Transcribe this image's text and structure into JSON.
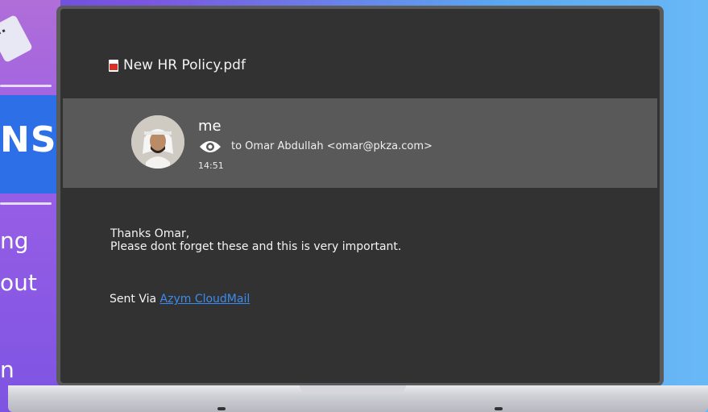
{
  "background": {
    "banner_text": "NS",
    "words": [
      "ng",
      "out",
      "n"
    ]
  },
  "email": {
    "attachment_name": "New HR Policy.pdf",
    "sender": "me",
    "to_line": "to Omar Abdullah <omar@pkza.com>",
    "time": "14:51",
    "body_lines": [
      "Thanks Omar,",
      "Please dont  forget these and this is very important."
    ],
    "sent_via_prefix": "Sent Via ",
    "sent_via_link": "Azym CloudMail"
  },
  "colors": {
    "screen": "#323232",
    "header_row": "#595959",
    "link": "#3a8cf0"
  }
}
